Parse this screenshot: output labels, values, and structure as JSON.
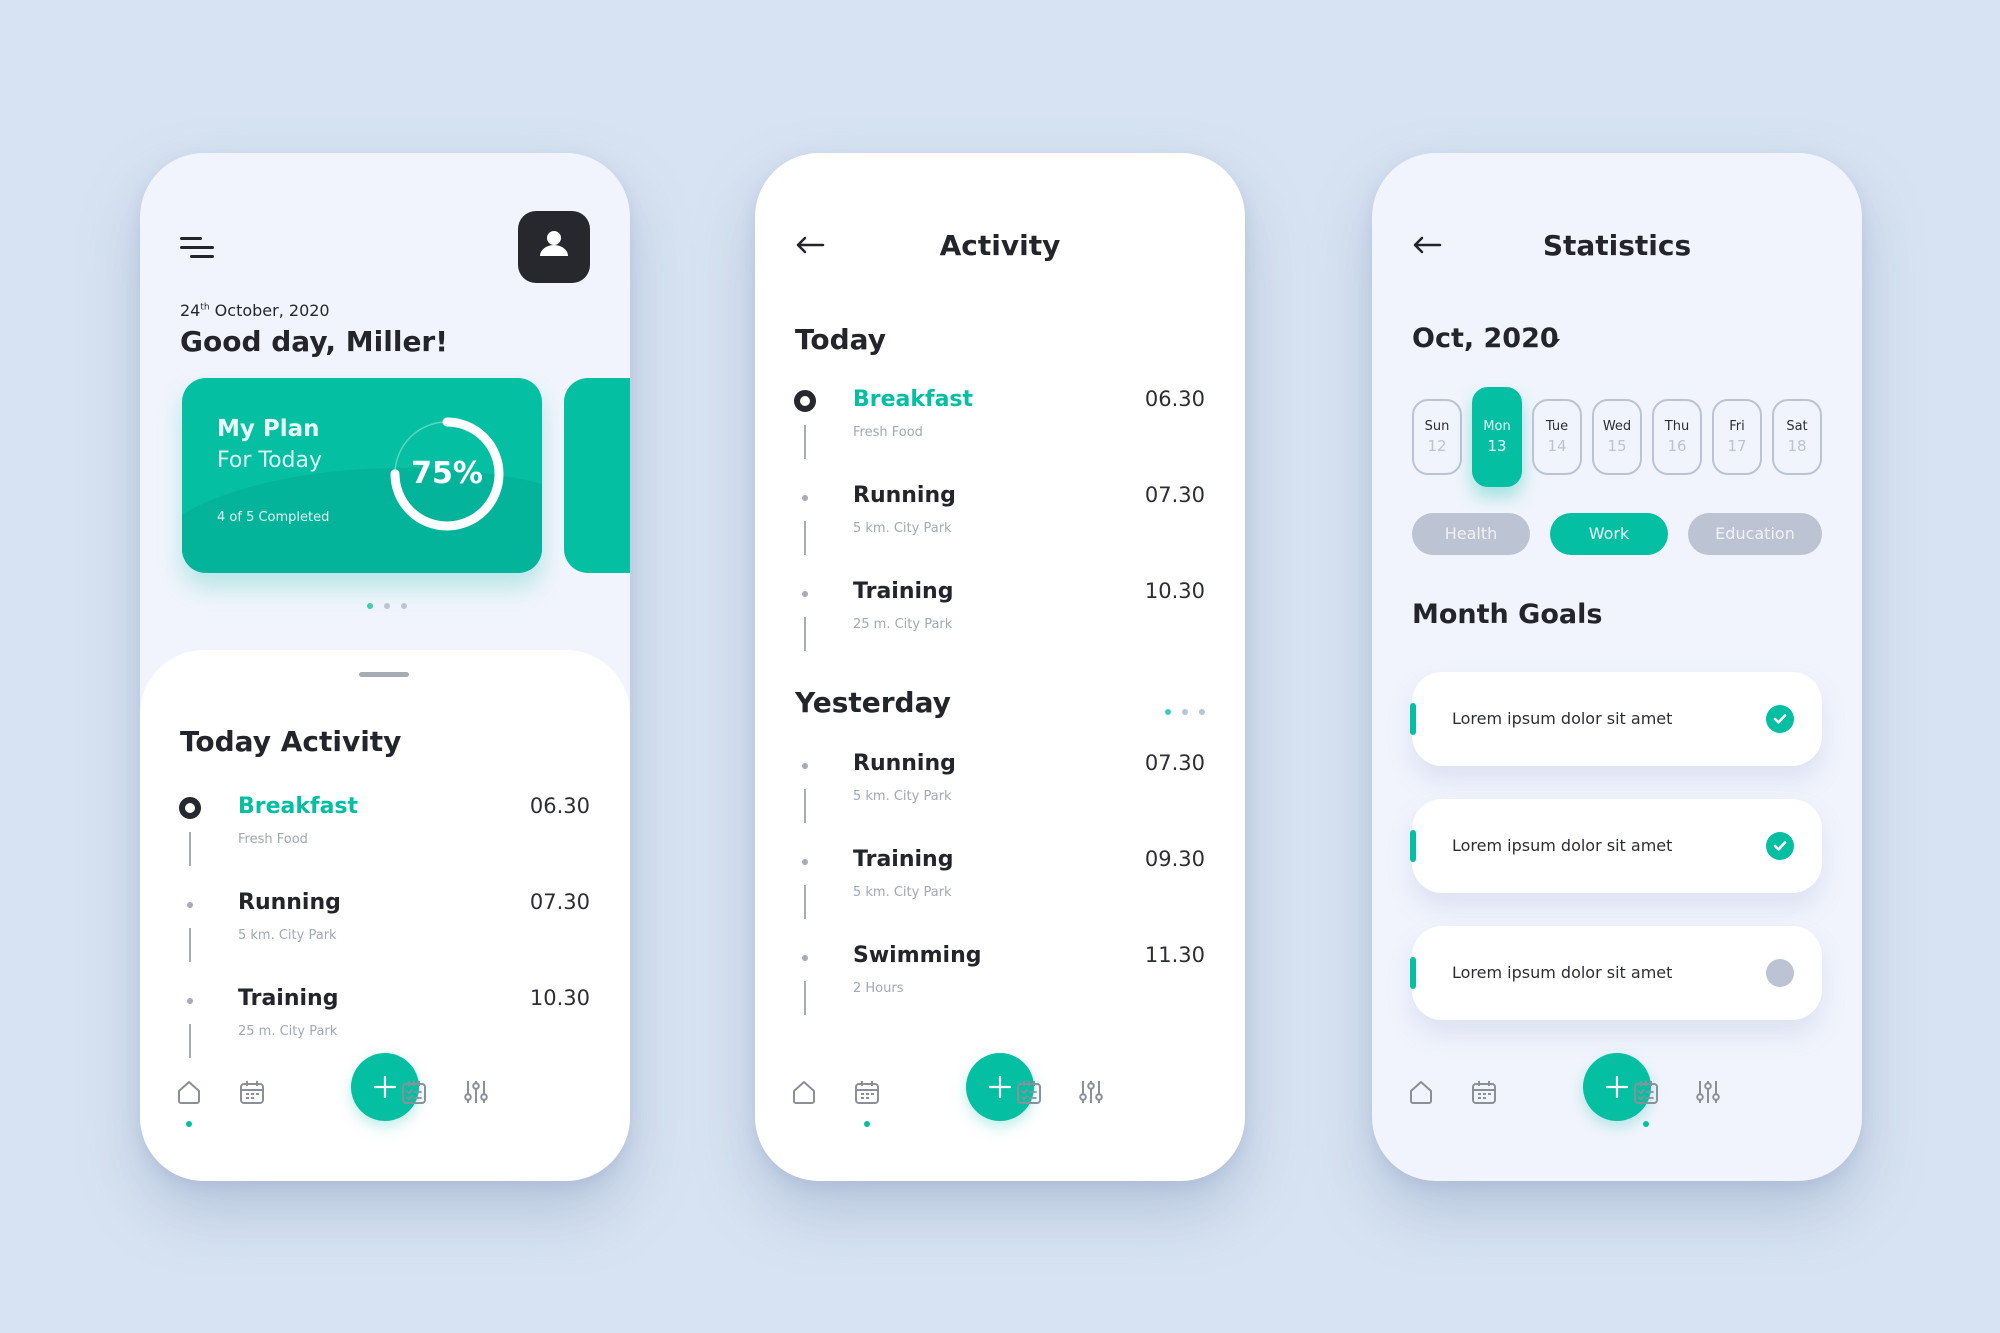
{
  "colors": {
    "accent": "#05bfa3",
    "ink": "#23252b",
    "muted": "#a3a8b4",
    "inactive": "#bcc3d2",
    "background": "#d7e3f2"
  },
  "home": {
    "date_day": "24",
    "date_suffix": "th",
    "date_rest": " October, 2020",
    "greeting": "Good day, Miller!",
    "plan_card": {
      "title": "My Plan",
      "subtitle": "For Today",
      "completed": "4 of 5 Completed",
      "progress_label": "75%",
      "progress": 0.75
    },
    "carousel_dots": 3,
    "carousel_active": 0,
    "sheet_title": "Today Activity",
    "activities": [
      {
        "name": "Breakfast",
        "desc": "Fresh Food",
        "time": "06.30",
        "active": true
      },
      {
        "name": "Running",
        "desc": "5 km. City Park",
        "time": "07.30",
        "active": false
      },
      {
        "name": "Training",
        "desc": "25 m. City Park",
        "time": "10.30",
        "active": false
      }
    ],
    "nav_active": "home"
  },
  "activity": {
    "title": "Activity",
    "today_label": "Today",
    "today": [
      {
        "name": "Breakfast",
        "desc": "Fresh Food",
        "time": "06.30",
        "active": true
      },
      {
        "name": "Running",
        "desc": "5 km. City Park",
        "time": "07.30",
        "active": false
      },
      {
        "name": "Training",
        "desc": "25 m. City Park",
        "time": "10.30",
        "active": false
      }
    ],
    "yesterday_label": "Yesterday",
    "yesterday": [
      {
        "name": "Running",
        "desc": "5 km. City Park",
        "time": "07.30",
        "active": false
      },
      {
        "name": "Training",
        "desc": "5 km. City Park",
        "time": "09.30",
        "active": false
      },
      {
        "name": "Swimming",
        "desc": "2 Hours",
        "time": "11.30",
        "active": false
      }
    ],
    "nav_active": "calendar"
  },
  "statistics": {
    "title": "Statistics",
    "month": "Oct, 2020",
    "days": [
      {
        "name": "Sun",
        "date": "12"
      },
      {
        "name": "Mon",
        "date": "13",
        "selected": true
      },
      {
        "name": "Tue",
        "date": "14"
      },
      {
        "name": "Wed",
        "date": "15"
      },
      {
        "name": "Thu",
        "date": "16"
      },
      {
        "name": "Fri",
        "date": "17"
      },
      {
        "name": "Sat",
        "date": "18"
      }
    ],
    "categories": [
      {
        "label": "Health",
        "active": false
      },
      {
        "label": "Work",
        "active": true
      },
      {
        "label": "Education",
        "active": false
      }
    ],
    "goals_title": "Month Goals",
    "goals": [
      {
        "text": "Lorem ipsum dolor sit amet",
        "done": true
      },
      {
        "text": "Lorem ipsum dolor sit amet",
        "done": true
      },
      {
        "text": "Lorem ipsum dolor sit amet",
        "done": false
      }
    ],
    "nav_active": "tasks"
  },
  "nav": {
    "items": [
      {
        "id": "home",
        "icon": "home-icon"
      },
      {
        "id": "calendar",
        "icon": "calendar-icon"
      },
      {
        "id": "add",
        "icon": "plus-icon"
      },
      {
        "id": "tasks",
        "icon": "checklist-icon"
      },
      {
        "id": "settings",
        "icon": "sliders-icon"
      }
    ]
  }
}
